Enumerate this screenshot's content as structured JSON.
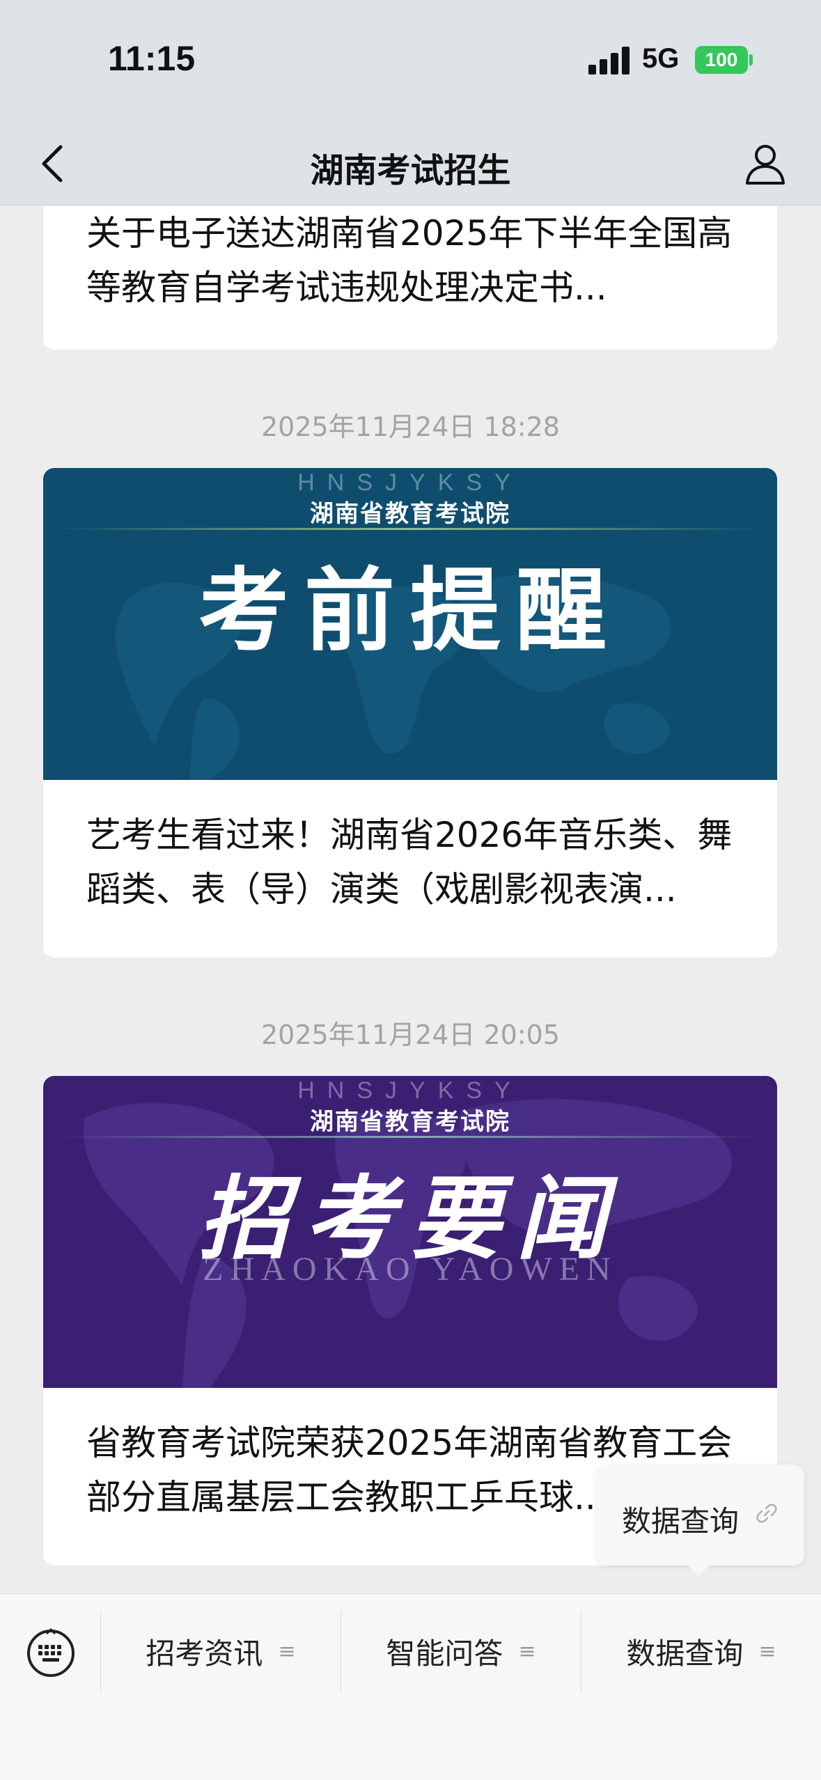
{
  "status_bar": {
    "time": "11:15",
    "network": "5G",
    "battery": "100"
  },
  "nav": {
    "title": "湖南考试招生",
    "back_icon": "chevron-left-icon",
    "profile_icon": "person-icon"
  },
  "articles": [
    {
      "title": "关于电子送达湖南省2025年下半年全国高等教育自学考试违规处理决定书..."
    },
    {
      "timestamp": "2025年11月24日 18:28",
      "banner": {
        "sub": "HNSJYKSY",
        "org": "湖南省教育考试院",
        "main": "考前提醒",
        "color": "#0e4d6e"
      },
      "title": "艺考生看过来！湖南省2026年音乐类、舞蹈类、表（导）演类（戏剧影视表演..."
    },
    {
      "timestamp": "2025年11月24日 20:05",
      "banner": {
        "sub": "HNSJYKSY",
        "org": "湖南省教育考试院",
        "main": "招考要闻",
        "en": "ZHAOKAO  YAOWEN",
        "color": "#3a1f73"
      },
      "title": "省教育考试院荣获2025年湖南省教育工会部分直属基层工会教职工乒乓球..."
    }
  ],
  "popup": {
    "label": "数据查询",
    "icon": "link-icon"
  },
  "bottom_menu": {
    "keyboard_icon": "keyboard-icon",
    "items": [
      {
        "label": "招考资讯"
      },
      {
        "label": "智能问答"
      },
      {
        "label": "数据查询"
      }
    ],
    "menu_icon": "≡"
  }
}
